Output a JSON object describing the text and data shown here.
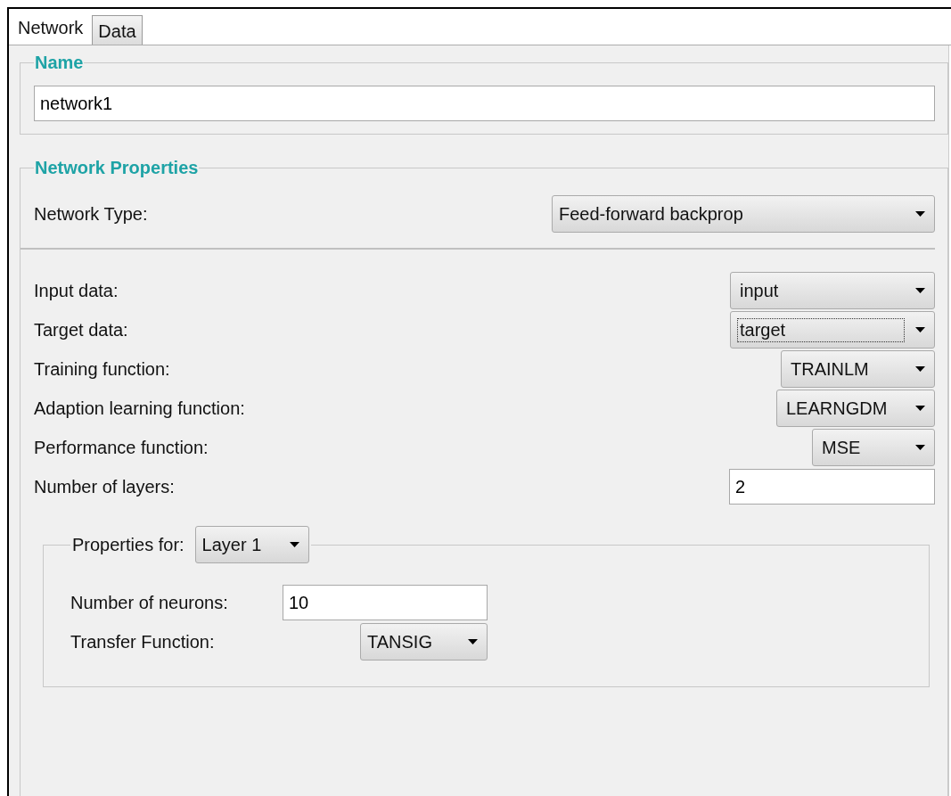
{
  "tabs": [
    {
      "label": "Network",
      "selected": true
    },
    {
      "label": "Data",
      "selected": false
    }
  ],
  "name_group": {
    "title": "Name",
    "field": {
      "value": "network1"
    }
  },
  "network_properties": {
    "title": "Network Properties",
    "network_type": {
      "label": "Network Type:",
      "value": "Feed-forward backprop"
    },
    "rows": [
      {
        "kind": "dropdown",
        "label": "Input data:",
        "value": "input",
        "focused": false
      },
      {
        "kind": "dropdown",
        "label": "Target data:",
        "value": "target",
        "focused": true
      },
      {
        "kind": "dropdown",
        "label": "Training function:",
        "value": "TRAINLM",
        "focused": false
      },
      {
        "kind": "dropdown",
        "label": "Adaption learning function:",
        "value": "LEARNGDM",
        "focused": false
      },
      {
        "kind": "dropdown",
        "label": "Performance function:",
        "value": "MSE",
        "focused": false
      },
      {
        "kind": "field",
        "label": "Number of layers:",
        "value": "2"
      }
    ],
    "layer_group": {
      "label": "Properties for:",
      "layer": "Layer 1",
      "neurons": {
        "label": "Number of neurons:",
        "value": "10"
      },
      "transfer": {
        "label": "Transfer Function:",
        "value": "TANSIG"
      }
    }
  }
}
